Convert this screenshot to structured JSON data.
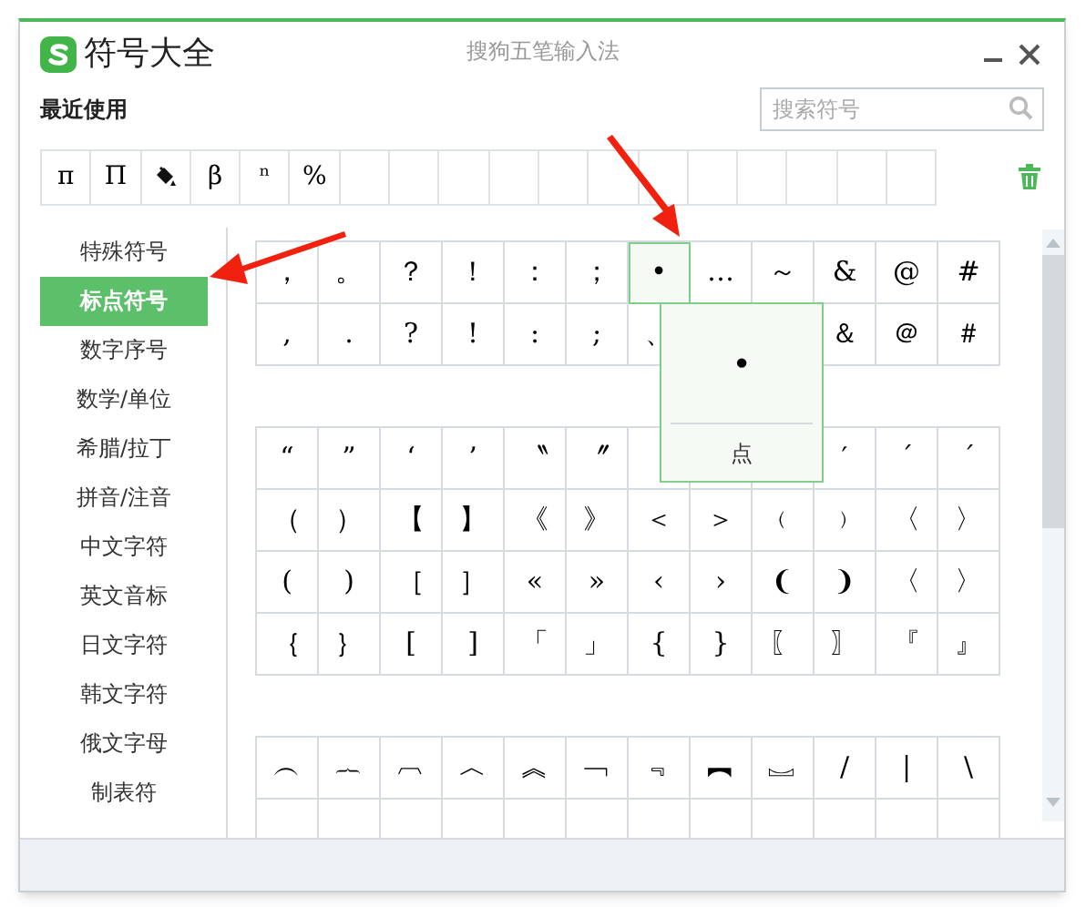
{
  "window": {
    "title": "符号大全",
    "app_name": "搜狗五笔输入法"
  },
  "recent": {
    "label": "最近使用",
    "items": [
      {
        "kind": "symbol",
        "symbol": "π"
      },
      {
        "kind": "symbol",
        "symbol": "Π"
      },
      {
        "kind": "icon"
      },
      {
        "kind": "symbol",
        "symbol": "β"
      },
      {
        "kind": "symbol",
        "symbol": "ⁿ"
      },
      {
        "kind": "symbol",
        "symbol": "%"
      }
    ]
  },
  "search": {
    "placeholder": "搜索符号"
  },
  "sidebar": {
    "items": [
      {
        "label": "特殊符号",
        "selected": false
      },
      {
        "label": "标点符号",
        "selected": true
      },
      {
        "label": "数字序号",
        "selected": false
      },
      {
        "label": "数学/单位",
        "selected": false
      },
      {
        "label": "希腊/拉丁",
        "selected": false
      },
      {
        "label": "拼音/注音",
        "selected": false
      },
      {
        "label": "中文字符",
        "selected": false
      },
      {
        "label": "英文音标",
        "selected": false
      },
      {
        "label": "日文字符",
        "selected": false
      },
      {
        "label": "韩文字符",
        "selected": false
      },
      {
        "label": "俄文字母",
        "selected": false
      },
      {
        "label": "制表符",
        "selected": false
      }
    ]
  },
  "sections": [
    {
      "rows": [
        [
          {
            "symbol": "，",
            "selected": false
          },
          {
            "symbol": "。",
            "selected": false
          },
          {
            "symbol": "？",
            "selected": false
          },
          {
            "symbol": "！",
            "selected": false
          },
          {
            "symbol": "：",
            "selected": false
          },
          {
            "symbol": "；",
            "selected": false
          },
          {
            "symbol": "•",
            "selected": true
          },
          {
            "symbol": "…",
            "selected": false
          },
          {
            "symbol": "～",
            "selected": false
          },
          {
            "symbol": "&",
            "selected": false
          },
          {
            "symbol": "@",
            "selected": false
          },
          {
            "symbol": "#",
            "selected": false
          }
        ],
        [
          {
            "symbol": ",",
            "selected": false
          },
          {
            "symbol": ".",
            "selected": false
          },
          {
            "symbol": "?",
            "selected": false
          },
          {
            "symbol": "!",
            "selected": false
          },
          {
            "symbol": ":",
            "selected": false
          },
          {
            "symbol": ";",
            "selected": false
          },
          {
            "symbol": "、",
            "selected": false
          },
          null,
          null,
          {
            "symbol": "＆",
            "selected": false
          },
          {
            "symbol": "＠",
            "selected": false
          },
          {
            "symbol": "＃",
            "selected": false
          }
        ]
      ]
    },
    {
      "rows": [
        [
          {
            "symbol": "“",
            "selected": false
          },
          {
            "symbol": "”",
            "selected": false
          },
          {
            "symbol": "‘",
            "selected": false
          },
          {
            "symbol": "’",
            "selected": false
          },
          {
            "symbol": "〝",
            "selected": false
          },
          {
            "symbol": "〞",
            "selected": false
          },
          null,
          null,
          null,
          {
            "symbol": "′",
            "selected": false
          },
          {
            "symbol": "´",
            "selected": false
          },
          {
            "symbol": "ˊ",
            "selected": false
          }
        ],
        [
          {
            "symbol": "（",
            "selected": false
          },
          {
            "symbol": "）",
            "selected": false
          },
          {
            "symbol": "【",
            "selected": false
          },
          {
            "symbol": "】",
            "selected": false
          },
          {
            "symbol": "《",
            "selected": false
          },
          {
            "symbol": "》",
            "selected": false
          },
          {
            "symbol": "＜",
            "selected": false
          },
          {
            "symbol": "＞",
            "selected": false
          },
          {
            "symbol": "﹙",
            "selected": false
          },
          {
            "symbol": "﹚",
            "selected": false
          },
          {
            "symbol": "〈",
            "selected": false
          },
          {
            "symbol": "〉",
            "selected": false
          }
        ],
        [
          {
            "symbol": "(",
            "selected": false
          },
          {
            "symbol": ")",
            "selected": false
          },
          {
            "symbol": "［",
            "selected": false
          },
          {
            "symbol": "］",
            "selected": false
          },
          {
            "symbol": "«",
            "selected": false
          },
          {
            "symbol": "»",
            "selected": false
          },
          {
            "symbol": "‹",
            "selected": false
          },
          {
            "symbol": "›",
            "selected": false
          },
          {
            "symbol": "❨",
            "selected": false
          },
          {
            "symbol": "❩",
            "selected": false
          },
          {
            "symbol": "〈",
            "selected": false
          },
          {
            "symbol": "〉",
            "selected": false
          }
        ],
        [
          {
            "symbol": "｛",
            "selected": false
          },
          {
            "symbol": "｝",
            "selected": false
          },
          {
            "symbol": "[",
            "selected": false
          },
          {
            "symbol": "]",
            "selected": false
          },
          {
            "symbol": "「",
            "selected": false
          },
          {
            "symbol": "」",
            "selected": false
          },
          {
            "symbol": "{",
            "selected": false
          },
          {
            "symbol": "}",
            "selected": false
          },
          {
            "symbol": "〖",
            "selected": false
          },
          {
            "symbol": "〗",
            "selected": false
          },
          {
            "symbol": "『",
            "selected": false
          },
          {
            "symbol": "』",
            "selected": false
          }
        ]
      ]
    },
    {
      "rows": [
        [
          {
            "symbol": "︵",
            "selected": false
          },
          {
            "symbol": "︷",
            "selected": false
          },
          {
            "symbol": "︹",
            "selected": false
          },
          {
            "symbol": "︿",
            "selected": false
          },
          {
            "symbol": "︽",
            "selected": false
          },
          {
            "symbol": "﹁",
            "selected": false
          },
          {
            "symbol": "﹃",
            "selected": false
          },
          {
            "symbol": "︻",
            "selected": false
          },
          {
            "symbol": "︗",
            "selected": false
          },
          {
            "symbol": "/",
            "selected": false
          },
          {
            "symbol": "|",
            "selected": false
          },
          {
            "symbol": "\\",
            "selected": false
          }
        ]
      ],
      "cut_off_row": true
    }
  ],
  "tooltip": {
    "symbol": "•",
    "name": "点"
  }
}
